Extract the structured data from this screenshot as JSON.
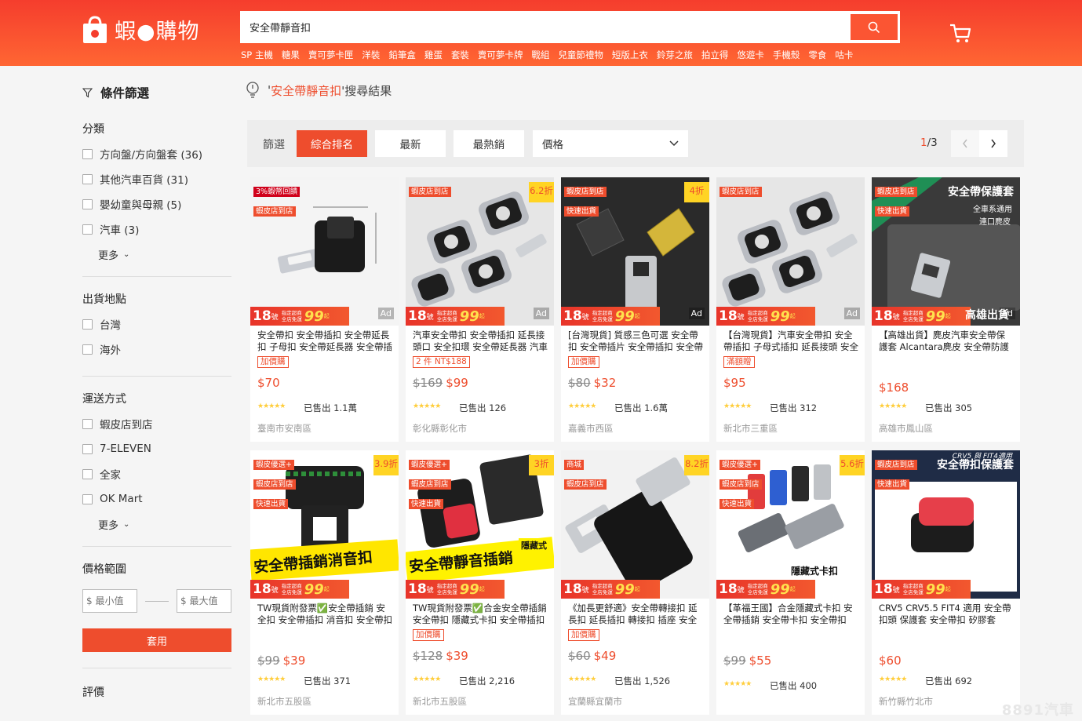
{
  "header": {
    "logo_text": "蝦●購物",
    "search_value": "安全帶靜音扣",
    "hotwords": [
      "SP 主機",
      "糖果",
      "賣可夢卡匣",
      "洋裝",
      "鉛筆盒",
      "雞蛋",
      "套裝",
      "賣可夢卡牌",
      "戰組",
      "兒童節禮物",
      "短版上衣",
      "鈴芽之旅",
      "拍立得",
      "悠遊卡",
      "手機殼",
      "零食",
      "咕卡"
    ]
  },
  "sidebar": {
    "title": "條件篩選",
    "category": {
      "title": "分類",
      "options": [
        "方向盤/方向盤套 (36)",
        "其他汽車百貨 (31)",
        "嬰幼童與母親 (5)",
        "汽車 (3)"
      ],
      "more": "更多"
    },
    "location": {
      "title": "出貨地點",
      "options": [
        "台灣",
        "海外"
      ]
    },
    "shipping": {
      "title": "運送方式",
      "options": [
        "蝦皮店到店",
        "7-ELEVEN",
        "全家",
        "OK Mart"
      ],
      "more": "更多"
    },
    "price_range": {
      "title": "價格範圍",
      "min_placeholder": "$ 最小值",
      "max_placeholder": "$ 最大值",
      "apply": "套用"
    },
    "rating": {
      "title": "評價"
    }
  },
  "results": {
    "quote_open": "'",
    "keyword": "安全帶靜音扣",
    "suffix": "'搜尋結果"
  },
  "sortbar": {
    "label": "篩選",
    "relevance": "綜合排名",
    "latest": "最新",
    "top_sales": "最熱銷",
    "price": "價格",
    "page_current": "1",
    "page_total": "/3"
  },
  "products": [
    {
      "title": "安全帶扣 安全帶插扣 安全帶延長扣 子母扣 安全帶延長器 安全帶插片",
      "tag": "加價購",
      "old_price": "",
      "price": "$70",
      "sold": "已售出 1.1萬",
      "location": "臺南市安南區",
      "discount": "",
      "badges": [
        "3%蝦幣回饋",
        "蝦皮店到店"
      ],
      "ad": "Ad"
    },
    {
      "title": "汽車安全帶扣 安全帶插扣 延長接頭口 安全扣環 安全帶延長器 汽車用品",
      "tag": "2 件 NT$188",
      "old_price": "$169",
      "price": "$99",
      "sold": "已售出 126",
      "location": "彰化縣彰化市",
      "discount": "6.2折",
      "badges": [
        "蝦皮店到店"
      ],
      "ad": "Ad"
    },
    {
      "title": "[台灣現貨] 質感三色可選 安全帶扣 安全帶插片 安全帶插扣 安全帶延長",
      "tag": "加價購",
      "old_price": "$80",
      "price": "$32",
      "sold": "已售出 1.6萬",
      "location": "嘉義市西區",
      "discount": "4折",
      "badges": [
        "蝦皮店到店",
        "快速出貨"
      ],
      "ad": "Ad"
    },
    {
      "title": "【台灣現貨】汽車安全帶扣 安全帶插扣 子母式插扣 延長接頭 安全帶",
      "tag": "滿額贈",
      "old_price": "",
      "price": "$95",
      "sold": "已售出 312",
      "location": "新北市三重區",
      "discount": "",
      "badges": [
        "蝦皮店到店"
      ],
      "ad": "Ad"
    },
    {
      "title": "【高雄出貨】麂皮汽車安全帶保護套 Alcantara麂皮 安全帶防護套",
      "tag": "",
      "old_price": "",
      "price": "$168",
      "sold": "已售出 305",
      "location": "高雄市鳳山區",
      "discount": "",
      "badges": [
        "蝦皮店到店",
        "快速出貨"
      ],
      "ad": "Ad",
      "img_title": "安全帶保護套",
      "img_sub1": "全車系通用",
      "img_sub2": "連口麂皮",
      "img_bottom": "高雄出貨"
    },
    {
      "title": "TW現貨附發票✅安全帶插銷 安全扣 安全帶插扣 消音扣 安全帶扣",
      "tag": "",
      "old_price": "$99",
      "price": "$39",
      "sold": "已售出 371",
      "location": "新北市五股區",
      "discount": "3.9折",
      "badges": [
        "蝦皮優選+",
        "蝦皮店到店",
        "快速出貨"
      ],
      "ad": "",
      "img_banner": "安全帶插銷消音扣"
    },
    {
      "title": "TW現貨附發票✅合金安全帶插銷 安全帶扣 隱藏式卡扣 安全帶插扣",
      "tag": "加價購",
      "old_price": "$128",
      "price": "$39",
      "sold": "已售出 2,216",
      "location": "新北市五股區",
      "discount": "3折",
      "badges": [
        "蝦皮優選+",
        "蝦皮店到店",
        "快速出貨"
      ],
      "ad": "",
      "img_banner": "安全帶靜音插銷",
      "img_corner": "隱藏式"
    },
    {
      "title": "《加長更舒適》安全帶轉接扣 延長扣 延長插扣 轉接扣 插座 安全帶",
      "tag": "加價購",
      "old_price": "$60",
      "price": "$49",
      "sold": "已售出 1,526",
      "location": "宜蘭縣宜蘭市",
      "discount": "8.2折",
      "badges": [
        "商城",
        "蝦皮店到店"
      ],
      "ad": ""
    },
    {
      "title": "【革福王國】合金隱藏式卡扣 安全帶插銷 安全帶卡扣 安全帶扣",
      "tag": "",
      "old_price": "$99",
      "price": "$55",
      "sold": "已售出 400",
      "location": "",
      "discount": "5.6折",
      "badges": [
        "蝦皮優選+",
        "蝦皮店到店",
        "快速出貨"
      ],
      "ad": "",
      "img_bottom": "隱藏式卡扣"
    },
    {
      "title": "CRV5 CRV5.5 FIT4 適用 安全帶 扣頭 保護套 安全帶扣 矽膠套",
      "tag": "",
      "old_price": "",
      "price": "$60",
      "sold": "已售出 692",
      "location": "新竹縣竹北市",
      "discount": "",
      "badges": [
        "蝦皮店到店",
        "快速出貨"
      ],
      "ad": "",
      "img_title": "安全帶扣保護套",
      "img_sub1": "CRV5 與 FIT4適用"
    }
  ],
  "promo": {
    "day": "18",
    "day_unit": "號",
    "line1": "指定超商",
    "line2": "全店免運",
    "amount": "99",
    "unit": "起"
  },
  "watermark": "8891汽車",
  "colors": {
    "brand": "#ee4d2d",
    "header": "#f53d2d",
    "discount_bg": "#ffd424"
  }
}
